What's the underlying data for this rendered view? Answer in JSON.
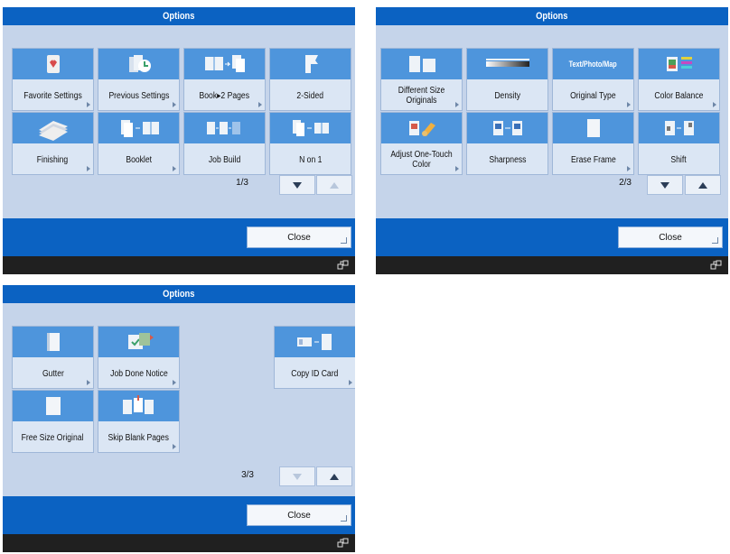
{
  "panels": [
    {
      "title": "Options",
      "tiles": [
        "Favorite Settings",
        "Previous Settings",
        "Book▸2 Pages",
        "2-Sided",
        "Finishing",
        "Booklet",
        "Job Build",
        "N on 1"
      ],
      "page": "1/3",
      "close": "Close"
    },
    {
      "title": "Options",
      "tiles": [
        "Different Size Originals",
        "Density",
        "Original Type",
        "Color Balance",
        "Adjust One-Touch Color",
        "Sharpness",
        "Erase Frame",
        "Shift"
      ],
      "page": "2/3",
      "close": "Close",
      "density_label": "Text/Photo/Map"
    },
    {
      "title": "Options",
      "tiles": [
        "Gutter",
        "Job Done Notice",
        "Copy ID Card",
        "Free Size Original",
        "Skip Blank Pages"
      ],
      "page": "3/3",
      "close": "Close"
    }
  ],
  "icons": {
    "network": "network-icon",
    "tile_corner": "arrow-right-icon"
  },
  "colors": {
    "title_bar": "#0b62c2",
    "panel_bg": "#c5d4ea",
    "tile_icon_bg": "#4e95dc",
    "tile_bg": "#dbe6f4",
    "footer": "#202020"
  }
}
